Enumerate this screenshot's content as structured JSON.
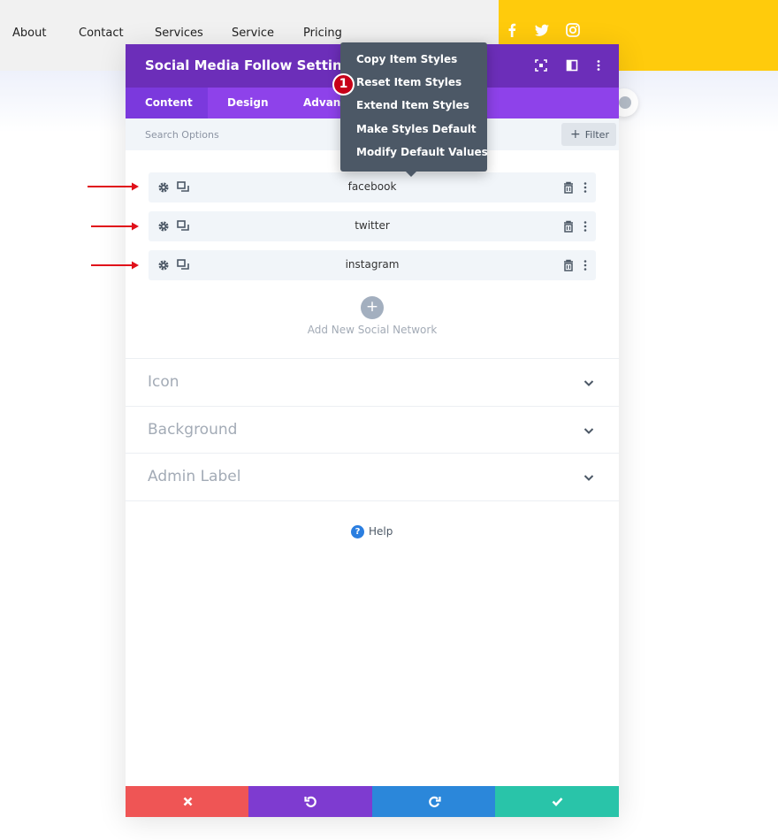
{
  "nav": {
    "items": [
      "About",
      "Contact",
      "Services",
      "Service",
      "Pricing"
    ]
  },
  "social_header_icons": [
    "facebook-icon",
    "twitter-icon",
    "instagram-icon"
  ],
  "modal": {
    "title": "Social Media Follow Settings",
    "header_icons": [
      "focus-icon",
      "split-view-icon",
      "more-options-icon"
    ],
    "tabs": [
      {
        "label": "Content",
        "active": true
      },
      {
        "label": "Design",
        "active": false
      },
      {
        "label": "Advanc",
        "active": false
      }
    ],
    "search": {
      "placeholder": "Search Options",
      "value": ""
    },
    "filter_label": "Filter",
    "items": [
      {
        "label": "facebook"
      },
      {
        "label": "twitter"
      },
      {
        "label": "instagram"
      }
    ],
    "add_label": "Add New Social Network",
    "add_icon": "+",
    "sections": [
      {
        "title": "Icon"
      },
      {
        "title": "Background"
      },
      {
        "title": "Admin Label"
      }
    ],
    "help": {
      "label": "Help",
      "icon": "?"
    }
  },
  "context_menu": {
    "items": [
      {
        "label": "Copy Item Styles"
      },
      {
        "label": "Reset Item Styles"
      },
      {
        "label": "Extend Item Styles"
      },
      {
        "label": "Make Styles Default"
      },
      {
        "label": "Modify Default Values"
      }
    ],
    "step_badge": "1"
  },
  "colors": {
    "header_purple": "#6c2eb9",
    "tab_purple": "#8e42ea",
    "menu_gray": "#4c5866",
    "yellow": "#ffcb0c",
    "cancel_red": "#ef5555",
    "undo_purple": "#7e3bd0",
    "redo_blue": "#2b87da",
    "save_green": "#29c4a9",
    "arrow_red": "#e0101a"
  }
}
